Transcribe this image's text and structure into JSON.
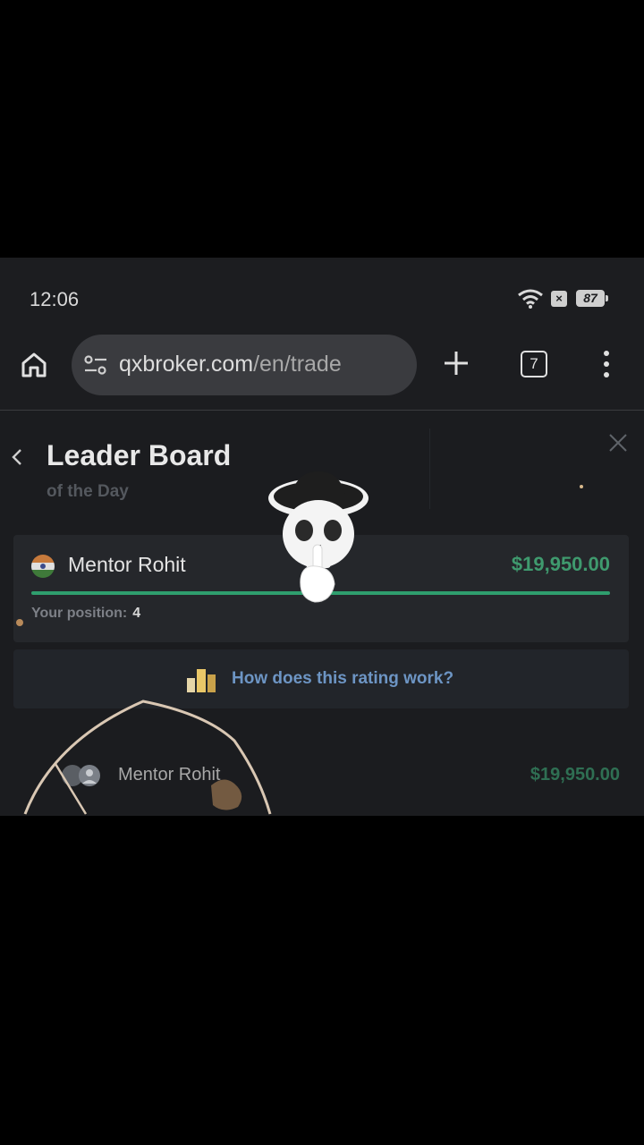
{
  "status_bar": {
    "time": "12:06",
    "battery": "87",
    "icons": [
      "wifi-icon",
      "no-sim-icon",
      "battery-icon"
    ]
  },
  "browser": {
    "url_domain": "qxbroker.com",
    "url_path": "/en/trade",
    "tab_count": "7",
    "icons": [
      "home-icon",
      "site-settings-icon",
      "new-tab-icon",
      "tab-switcher-icon",
      "more-menu-icon"
    ]
  },
  "leaderboard": {
    "title": "Leader Board",
    "subtitle": "of the Day",
    "me": {
      "name": "Mentor Rohit",
      "amount": "$19,950.00",
      "position_label": "Your position:",
      "position_value": "4",
      "progress_fraction": 1.0
    },
    "how_it_works": "How does this rating work?",
    "rows": [
      {
        "name": "Mentor Rohit",
        "amount": "$19,950.00"
      }
    ]
  },
  "colors": {
    "accent_green": "#2f9e6e",
    "link_blue": "#6d95c4",
    "panel_bg": "#1b1c1f"
  }
}
